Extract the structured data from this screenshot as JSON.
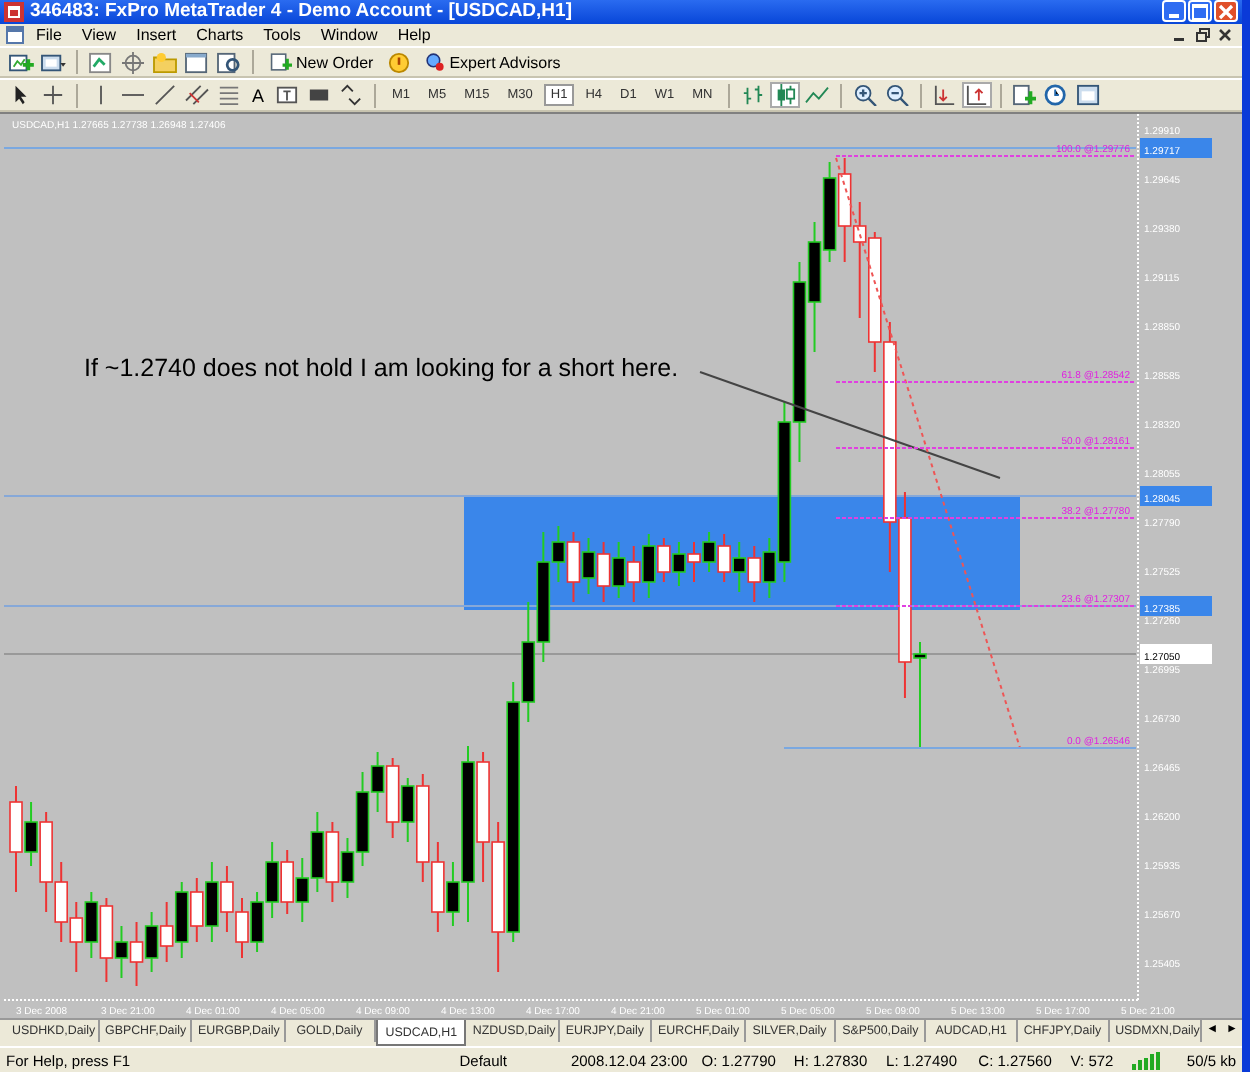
{
  "window": {
    "title": "346483: FxPro MetaTrader 4 - Demo Account - [USDCAD,H1]"
  },
  "menu": [
    "File",
    "View",
    "Insert",
    "Charts",
    "Tools",
    "Window",
    "Help"
  ],
  "toolbar": {
    "buttons": [
      "New Order",
      "Expert Advisors"
    ],
    "text_tool": "A",
    "timeframes": [
      {
        "label": "M1",
        "selected": false
      },
      {
        "label": "M5",
        "selected": false
      },
      {
        "label": "M15",
        "selected": false
      },
      {
        "label": "M30",
        "selected": false
      },
      {
        "label": "H1",
        "selected": true
      },
      {
        "label": "H4",
        "selected": false
      },
      {
        "label": "D1",
        "selected": false
      },
      {
        "label": "W1",
        "selected": false
      },
      {
        "label": "MN",
        "selected": false
      }
    ]
  },
  "chart": {
    "info": "USDCAD,H1  1.27665 1.27738 1.26948 1.27406",
    "annotation": "If ~1.2740 does not hold I am looking for a short here.",
    "fib_levels": [
      "100.0 @1.29776",
      "61.8 @1.28542",
      "50.0 @1.28161",
      "38.2 @1.27780",
      "23.6 @1.27307",
      "0.0 @1.26546"
    ],
    "price_ticks": [
      "1.29910",
      "1.29645",
      "1.29380",
      "1.29115",
      "1.28850",
      "1.28585",
      "1.28320",
      "1.28055",
      "1.27790",
      "1.27525",
      "1.27260",
      "1.26995",
      "1.26730",
      "1.26465",
      "1.26200",
      "1.25935",
      "1.25670",
      "1.25405"
    ],
    "price_markers": [
      {
        "label": "1.29717",
        "kind": "line"
      },
      {
        "label": "1.28045",
        "kind": "line"
      },
      {
        "label": "1.27385",
        "kind": "line"
      },
      {
        "label": "1.27050",
        "kind": "bid"
      }
    ],
    "time_labels": [
      "3 Dec 2008",
      "3 Dec 21:00",
      "4 Dec 01:00",
      "4 Dec 05:00",
      "4 Dec 09:00",
      "4 Dec 13:00",
      "4 Dec 17:00",
      "4 Dec 21:00",
      "5 Dec 01:00",
      "5 Dec 05:00",
      "5 Dec 09:00",
      "5 Dec 13:00",
      "5 Dec 17:00",
      "5 Dec 21:00"
    ]
  },
  "tabs": [
    {
      "label": "USDHKD,Daily",
      "selected": false
    },
    {
      "label": "GBPCHF,Daily",
      "selected": false
    },
    {
      "label": "EURGBP,Daily",
      "selected": false
    },
    {
      "label": "GOLD,Daily",
      "selected": false
    },
    {
      "label": "USDCAD,H1",
      "selected": true
    },
    {
      "label": "NZDUSD,Daily",
      "selected": false
    },
    {
      "label": "EURJPY,Daily",
      "selected": false
    },
    {
      "label": "EURCHF,Daily",
      "selected": false
    },
    {
      "label": "SILVER,Daily",
      "selected": false
    },
    {
      "label": "S&P500,Daily",
      "selected": false
    },
    {
      "label": "AUDCAD,H1",
      "selected": false
    },
    {
      "label": "CHFJPY,Daily",
      "selected": false
    },
    {
      "label": "USDMXN,Daily",
      "selected": false
    }
  ],
  "tab_scroll": [
    "◄",
    "►"
  ],
  "status_bar": {
    "help": "For Help, press F1",
    "profile": "Default",
    "time": "2008.12.04 23:00",
    "open": "O: 1.27790",
    "high": "H: 1.27830",
    "low": "L: 1.27490",
    "close": "C: 1.27560",
    "volume": "V: 572",
    "traffic": "50/5 kb"
  }
}
